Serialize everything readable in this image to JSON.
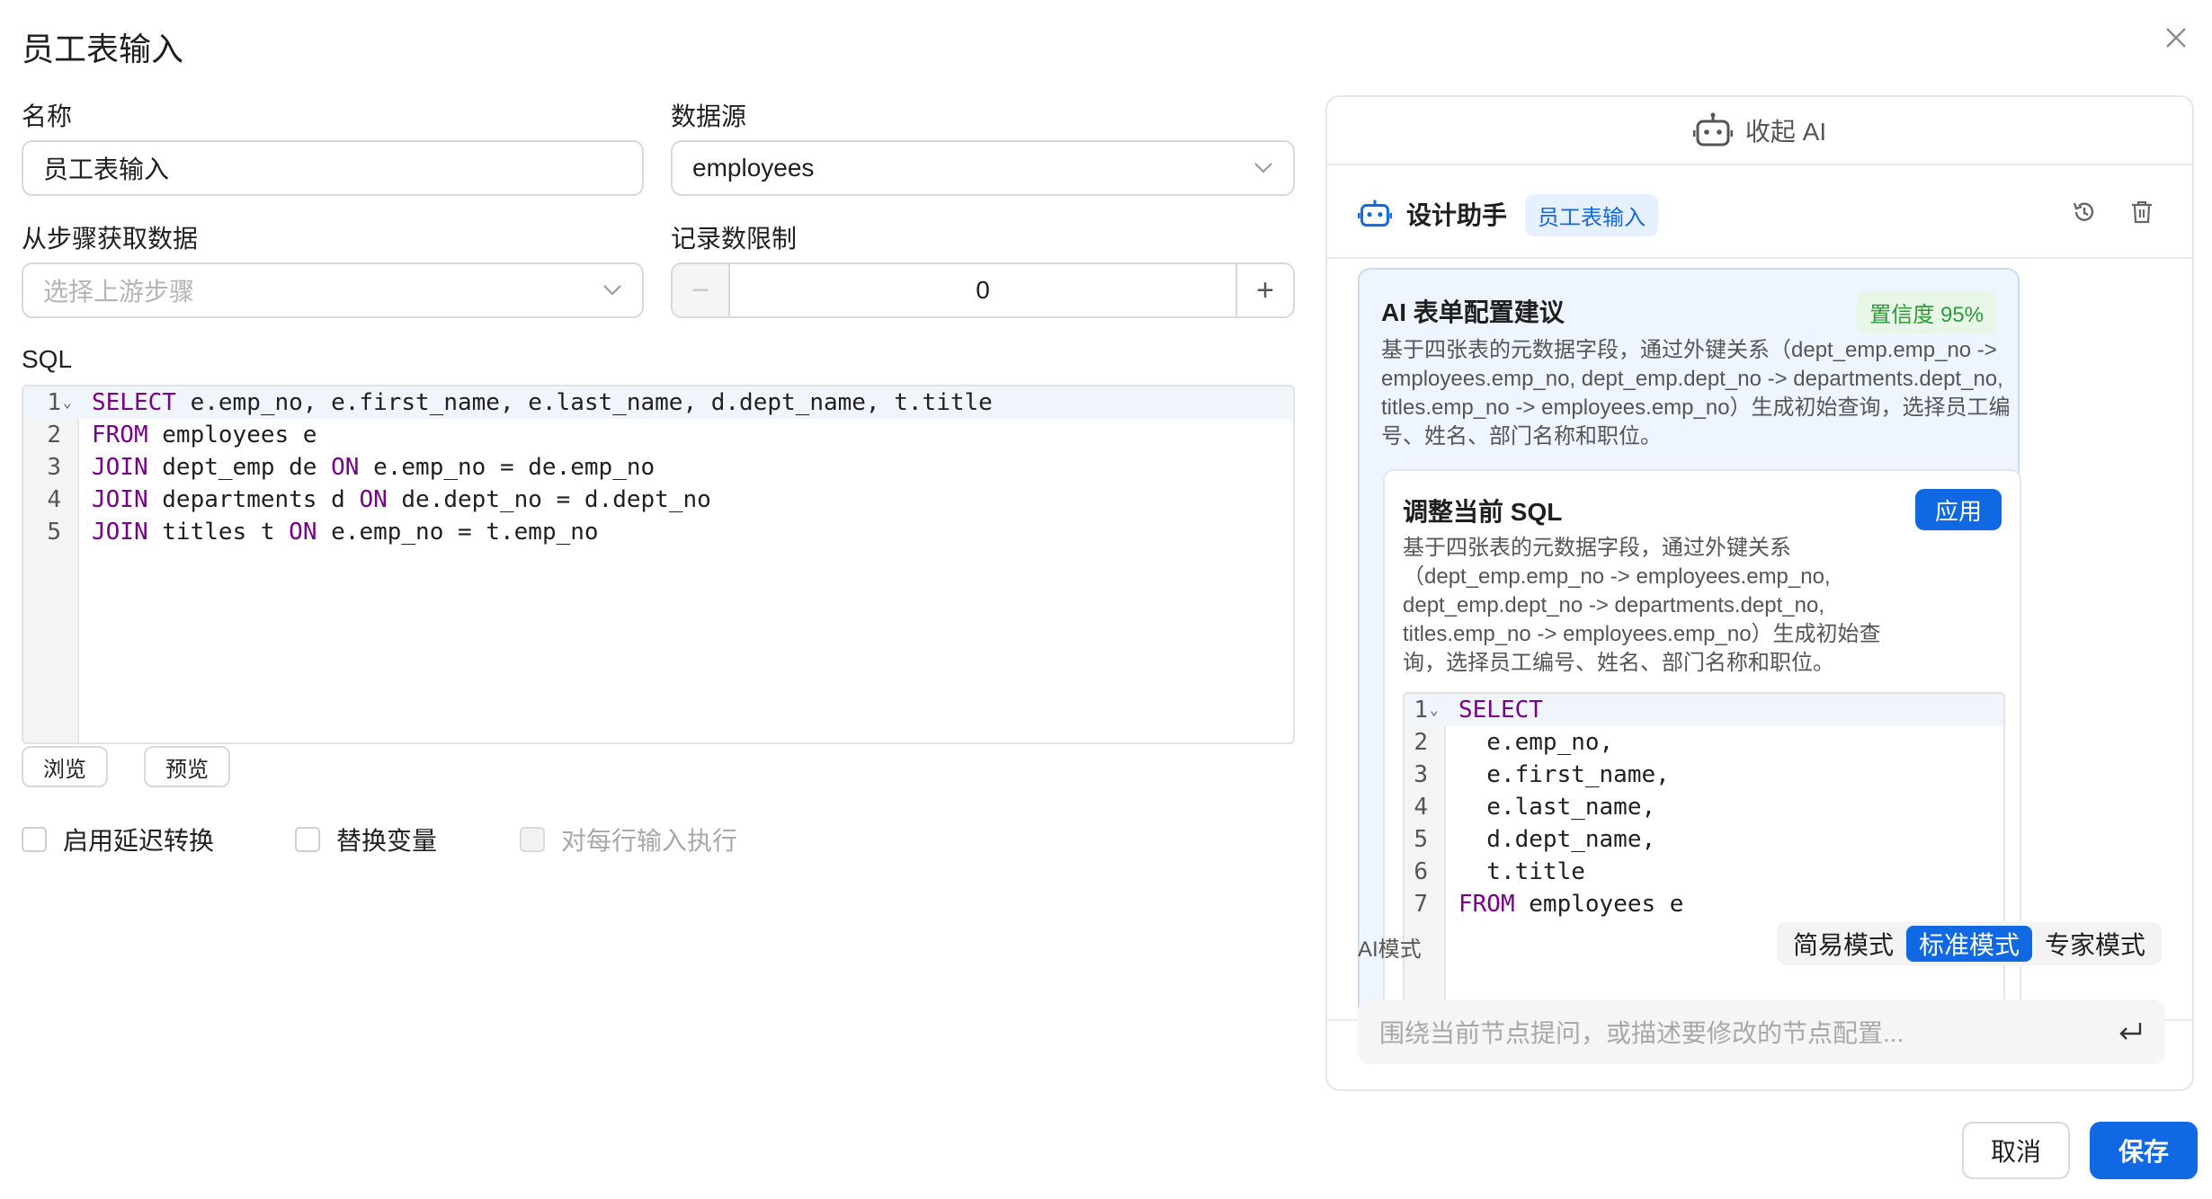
{
  "dialog": {
    "title": "员工表输入",
    "close_icon": "close-icon"
  },
  "form": {
    "name_label": "名称",
    "name_value": "员工表输入",
    "datasource_label": "数据源",
    "datasource_value": "employees",
    "from_step_label": "从步骤获取数据",
    "from_step_placeholder": "选择上游步骤",
    "limit_label": "记录数限制",
    "limit_value": "0",
    "minus_symbol": "−",
    "plus_symbol": "+",
    "sql_label": "SQL"
  },
  "sql_editor": {
    "lines": [
      {
        "no": "1",
        "text": "SELECT e.emp_no, e.first_name, e.last_name, d.dept_name, t.title"
      },
      {
        "no": "2",
        "text": "FROM employees e"
      },
      {
        "no": "3",
        "text": "JOIN dept_emp de ON e.emp_no = de.emp_no"
      },
      {
        "no": "4",
        "text": "JOIN departments d ON de.dept_no = d.dept_no"
      },
      {
        "no": "5",
        "text": "JOIN titles t ON e.emp_no = t.emp_no"
      }
    ]
  },
  "buttons": {
    "browse": "浏览",
    "preview": "预览",
    "cancel": "取消",
    "save": "保存"
  },
  "checkboxes": {
    "lazy": "启用延迟转换",
    "replace_vars": "替换变量",
    "each_row": "对每行输入执行"
  },
  "ai": {
    "collapse_label": "收起 AI",
    "assistant_title": "设计助手",
    "context_tag": "员工表输入",
    "suggestion": {
      "title": "AI 表单配置建议",
      "confidence": "置信度 95%",
      "desc_lines": [
        "基于四张表的元数据字段，通过外键关系（dept_emp.emp_no ->",
        "employees.emp_no, dept_emp.dept_no -> departments.dept_no,",
        "titles.emp_no -> employees.emp_no）生成初始查询，选择员工编",
        "号、姓名、部门名称和职位。"
      ],
      "inner": {
        "title": "调整当前 SQL",
        "apply": "应用",
        "desc_lines": [
          "基于四张表的元数据字段，通过外键关系",
          "（dept_emp.emp_no -> employees.emp_no,",
          "dept_emp.dept_no -> departments.dept_no,",
          "titles.emp_no -> employees.emp_no）生成初始查",
          "询，选择员工编号、姓名、部门名称和职位。"
        ],
        "code": [
          {
            "no": "1",
            "text": "SELECT"
          },
          {
            "no": "2",
            "text": "  e.emp_no,"
          },
          {
            "no": "3",
            "text": "  e.first_name,"
          },
          {
            "no": "4",
            "text": "  e.last_name,"
          },
          {
            "no": "5",
            "text": "  d.dept_name,"
          },
          {
            "no": "6",
            "text": "  t.title"
          },
          {
            "no": "7",
            "text": "FROM employees e"
          }
        ]
      }
    },
    "mode_label": "AI模式",
    "modes": [
      "简易模式",
      "标准模式",
      "专家模式"
    ],
    "active_mode": "标准模式",
    "input_placeholder": "围绕当前节点提问，或描述要修改的节点配置..."
  }
}
